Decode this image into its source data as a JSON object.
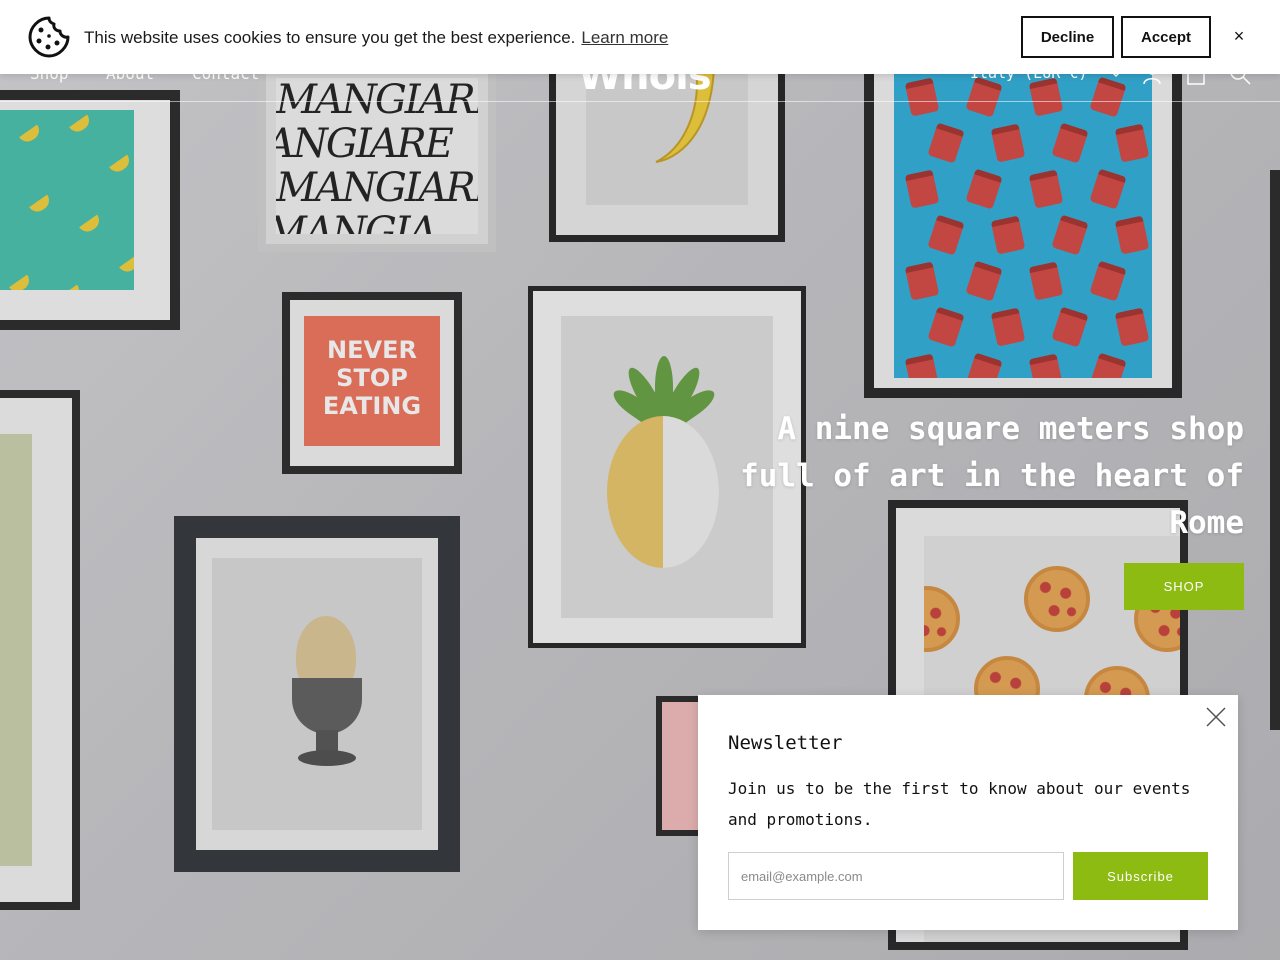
{
  "cookie_bar": {
    "icon": "cookie-icon",
    "message": "This website uses cookies to ensure you get the best experience.",
    "learn_more": "Learn more",
    "decline": "Decline",
    "accept": "Accept",
    "close": "×"
  },
  "header": {
    "nav": [
      "Shop",
      "About",
      "Contact"
    ],
    "logo": "Whols",
    "locale": "Italy (EUR €)",
    "icons": [
      "chevron-down-icon",
      "account-icon",
      "cart-icon",
      "search-icon"
    ]
  },
  "hero": {
    "headline": "A nine square meters shop full of art in the heart of Rome",
    "art_text_mangiare": "MANGIARE",
    "art_text_poster": "NEVER STOP EATING",
    "cta": "SHOP",
    "accent": "#8dbb12"
  },
  "newsletter": {
    "title": "Newsletter",
    "description": "Join us to be the first to know about our events and promotions.",
    "email_placeholder": "email@example.com",
    "email_value": "",
    "subscribe": "Subscribe",
    "close_icon": "close-icon"
  }
}
